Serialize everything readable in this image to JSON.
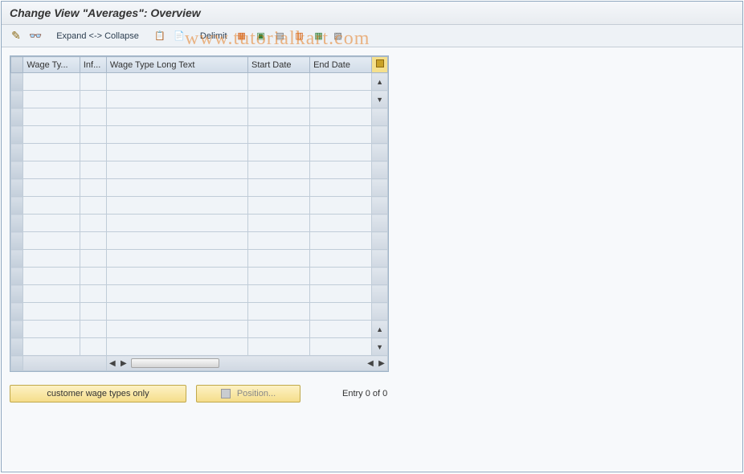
{
  "title": "Change View \"Averages\": Overview",
  "toolbar": {
    "expand_label": "Expand <-> Collapse",
    "delimit_label": "Delimit"
  },
  "table": {
    "columns": [
      "Wage Ty...",
      "Inf...",
      "Wage Type Long Text",
      "Start Date",
      "End Date"
    ],
    "row_count": 16
  },
  "buttons": {
    "customer": "customer wage types only",
    "position": "Position..."
  },
  "status": {
    "entry": "Entry 0 of 0"
  },
  "watermark": "www.tutorialkart.com",
  "icons": {
    "pencil": "✎",
    "glasses": "👓",
    "copy": "📋",
    "paste": "📄",
    "doc1": "▦",
    "doc2": "▣",
    "doc3": "▤",
    "doc4": "▥",
    "doc5": "▦",
    "doc6": "▧",
    "arrow_up": "▲",
    "arrow_down": "▼",
    "arrow_left": "◀",
    "arrow_right": "▶"
  }
}
